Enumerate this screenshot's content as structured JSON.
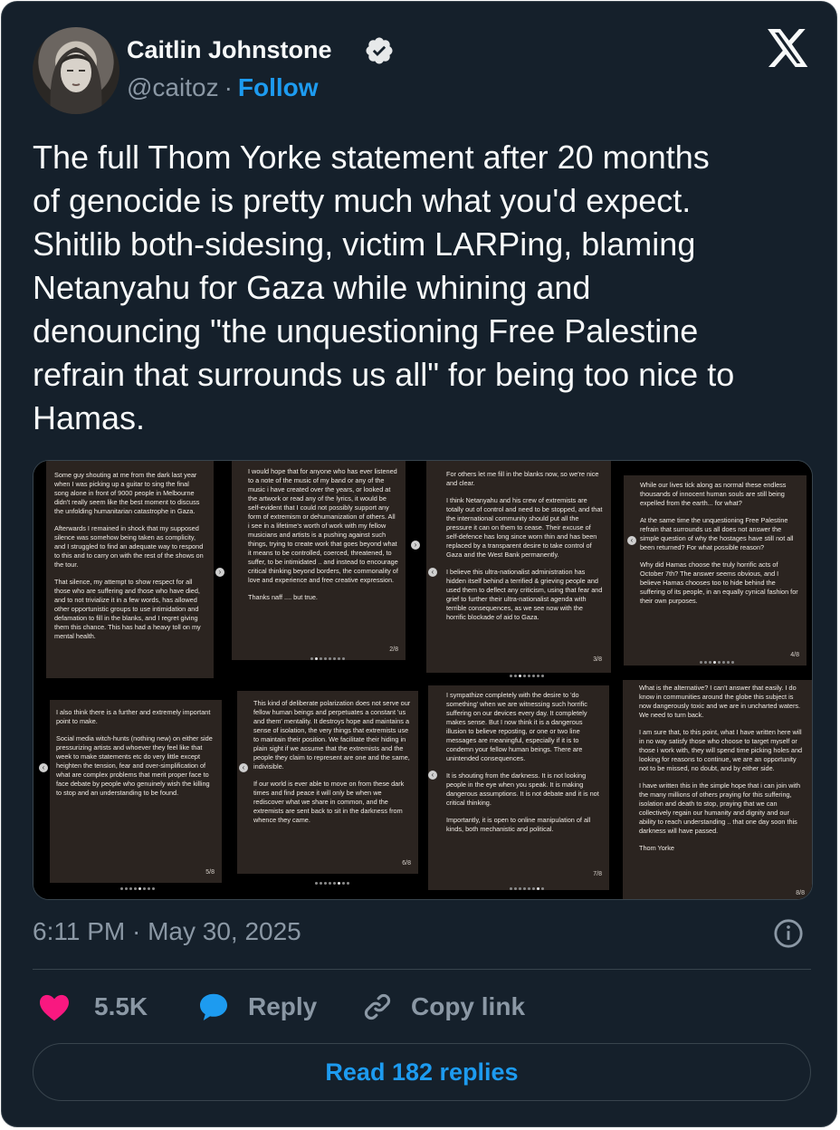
{
  "author": {
    "name": "Caitlin Johnstone",
    "handle": "@caitoz",
    "separator": "·",
    "follow_label": "Follow"
  },
  "tweet": {
    "text": "The full Thom Yorke statement after 20 months\nof genocide is pretty much what you'd expect.\nShitlib both-sidesing, victim LARPing, blaming\nNetanyahu for Gaza while whining and\ndenouncing \"the unquestioning Free Palestine\nrefrain that surrounds us all\" for being too nice to\nHamas.",
    "timestamp": "6:11 PM · May 30, 2025"
  },
  "media": {
    "tiles": [
      {
        "page": "1/8",
        "paragraphs": [
          "Some guy shouting at me from the dark last year when I was picking up a guitar to sing the final song alone in front of 9000 people in Melbourne didn't really seem like the best moment to discuss the unfolding humanitarian catastrophe in Gaza.",
          "Afterwards I remained in shock that my supposed silence was somehow being taken as complicity, and I struggled to find an adequate way to respond to this and to carry on with the rest of the shows on the tour.",
          "That silence, my attempt to show respect for all those who are suffering and those who have died, and to not trivialize it in a few words, has allowed other opportunistic groups to use intimidation and defamation to fill in the blanks, and I regret giving them this chance. This has had a heavy toll on my mental health."
        ]
      },
      {
        "page": "2/8",
        "paragraphs": [
          "I would hope that for anyone who has ever listened to a note of the music of my band or any of the music i have created over the years, or looked at the artwork or read any of the lyrics, it would be self-evident that I could not possibly support any form of extremism or dehumanization of others. All i see in a lifetime's worth of work with my fellow musicians and artists is a pushing against such things, trying to create work that goes beyond what it means to be controlled, coerced, threatened, to suffer, to be intimidated .. and instead to encourage critical thinking beyond borders, the commonality of love and experience and free creative expression.",
          "Thanks naff .... but true."
        ]
      },
      {
        "page": "3/8",
        "paragraphs": [
          "For others let me fill in the blanks now, so we're nice and clear.",
          "I think Netanyahu and his crew of extremists are totally out of control and need to be stopped, and that the international community should put all the pressure it can on them to cease. Their excuse of self-defence has long since worn thin and has been replaced by a transparent desire to take control of Gaza and the West Bank permanently.",
          "I believe this ultra-nationalist administration has hidden itself behind a terrified & grieving people and used them to deflect any criticism, using that fear and grief to further their ultra-nationalist agenda with terrible consequences, as we see now with the horrific blockade of aid to Gaza."
        ]
      },
      {
        "page": "4/8",
        "paragraphs": [
          "While our lives tick along as normal these endless thousands of innocent human souls are still being expelled from the earth... for what?",
          "At the same time the unquestioning Free Palestine refrain that surrounds us all does not answer the simple question of why the hostages have still not all been returned? For what possible reason?",
          "Why did Hamas choose the truly horrific acts of October 7th? The answer seems obvious, and I believe Hamas chooses too to hide behind the suffering of its people, in an equally cynical fashion for their own purposes."
        ]
      },
      {
        "page": "5/8",
        "paragraphs": [
          "I also think there is a further and extremely important point to make.",
          "Social media witch-hunts (nothing new) on either side pressurizing artists and whoever they feel like that week to make statements etc do very little except heighten the tension, fear and over-simplification of what are complex problems that merit proper face to face debate by people who genuinely wish the killing to stop and an understanding to be found."
        ]
      },
      {
        "page": "6/8",
        "paragraphs": [
          "This kind of deliberate polarization does not serve our fellow human beings and perpetuates a constant 'us and them' mentality. It destroys hope and maintains a sense of isolation, the very things that extremists use to maintain their position. We facilitate their hiding in plain sight if we assume that the extremists and the people they claim to represent are one and the same, indivisible.",
          "If our world is ever able to move on from these dark times and find peace it will only be when we rediscover what we share in common, and the extremists are sent back to sit in the darkness from whence they came."
        ]
      },
      {
        "page": "7/8",
        "paragraphs": [
          "I sympathize completely with the desire to 'do something' when we are witnessing such horrific suffering on our devices every day. It completely makes sense. But I now think it is a dangerous illusion to believe reposting, or one or two line messages are meaningful, especially if it is to condemn your fellow human beings. There are unintended consequences.",
          "It is shouting from the darkness. It is not looking people in the eye when you speak. It is making dangerous assumptions. It is not debate and it is not critical thinking.",
          "Importantly, it is open to online manipulation of all kinds, both mechanistic and political."
        ]
      },
      {
        "page": "8/8",
        "paragraphs": [
          "What is the alternative? I can't answer that easily. I do know in communities around the globe this subject is now dangerously toxic and we are in uncharted waters. We need to turn back.",
          "I am sure that, to this point, what I have written here will in no way satisfy those who choose to target myself or those i work with, they will spend time picking holes and looking for reasons to continue, we are an opportunity not to be missed, no doubt, and by either side.",
          "I have written this in the simple hope that i can join with the many millions of others praying for this suffering, isolation and death to stop, praying that we can collectively regain our humanity and dignity and our ability to reach understanding .. that one day soon this darkness will have passed.",
          "Thom Yorke"
        ]
      }
    ]
  },
  "actions": {
    "like_count": "5.5K",
    "reply_label": "Reply",
    "copy_link_label": "Copy link",
    "read_replies_label": "Read 182 replies"
  },
  "colors": {
    "background": "#15202b",
    "text": "#f7f9f9",
    "muted": "#8b98a5",
    "accent": "#1d9bf0",
    "like": "#f91880",
    "border": "#38444d"
  },
  "icons": [
    "verified-badge-icon",
    "x-logo-icon",
    "info-icon",
    "heart-icon",
    "reply-bubble-icon",
    "link-icon"
  ]
}
